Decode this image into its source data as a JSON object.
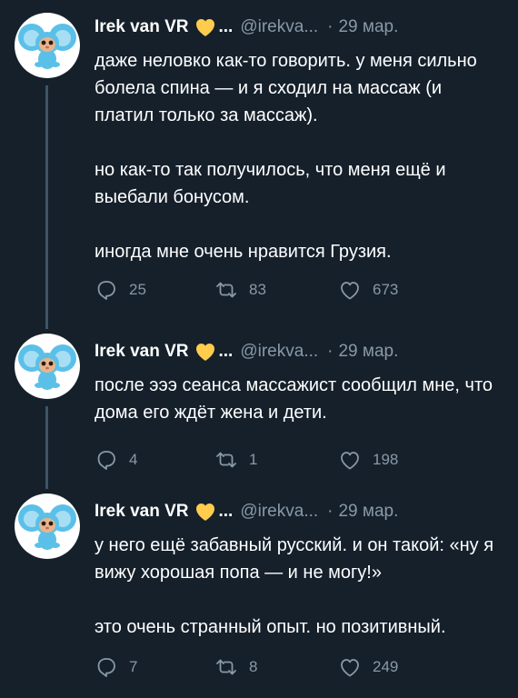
{
  "tweets": [
    {
      "author": {
        "name": "Irek van VR",
        "badge_icon": "yellow-heart-icon",
        "ellipsis": "...",
        "handle": "@irekva..."
      },
      "date": "29 мар.",
      "body": [
        "даже неловко как-то говорить. у меня сильно болела спина — и я сходил на массаж (и платил только за массаж).",
        "но как-то так получилось, что меня ещё и выебали бонусом.",
        "иногда мне очень нравится Грузия."
      ],
      "stats": {
        "replies": "25",
        "retweets": "83",
        "likes": "673"
      }
    },
    {
      "author": {
        "name": "Irek van VR",
        "badge_icon": "yellow-heart-icon",
        "ellipsis": "...",
        "handle": "@irekva..."
      },
      "date": "29 мар.",
      "body": [
        "после эээ сеанса массажист сообщил мне, что дома его ждёт жена и дети."
      ],
      "stats": {
        "replies": "4",
        "retweets": "1",
        "likes": "198"
      }
    },
    {
      "author": {
        "name": "Irek van VR",
        "badge_icon": "yellow-heart-icon",
        "ellipsis": "...",
        "handle": "@irekva..."
      },
      "date": "29 мар.",
      "body": [
        "у него ещё забавный русский. и он такой: «ну я вижу хорошая попа — и не могу!»",
        "это очень странный опыт. но позитивный."
      ],
      "stats": {
        "replies": "7",
        "retweets": "8",
        "likes": "249"
      }
    }
  ],
  "colors": {
    "background": "#15202b",
    "text": "#ffffff",
    "secondary": "#8899a6",
    "thread_line": "#3d5466",
    "heart": "#ffcc4d"
  }
}
